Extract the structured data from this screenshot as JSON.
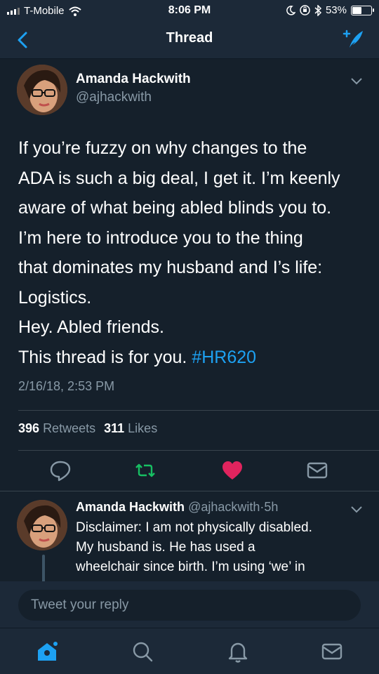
{
  "status_bar": {
    "carrier": "T-Mobile",
    "time": "8:06 PM",
    "battery": "53%",
    "battery_level": 0.53
  },
  "nav": {
    "title": "Thread",
    "back_icon": "chevron-left-icon",
    "compose_icon": "compose-tweet-icon"
  },
  "tweet": {
    "author_name": "Amanda Hackwith",
    "author_handle": "@ajhackwith",
    "lines": [
      "If you’re fuzzy on why changes to the",
      "ADA is such a big deal, I get it. I’m keenly",
      "aware of what being abled blinds you to.",
      "I’m here to introduce you to the thing",
      "that dominates my husband and I’s life:",
      "Logistics.",
      "Hey. Abled friends.",
      "This thread is for you."
    ],
    "hashtag": "#HR620",
    "timestamp": "2/16/18, 2:53 PM",
    "retweets_count": "396",
    "retweets_label": "Retweets",
    "likes_count": "311",
    "likes_label": "Likes",
    "liked": true,
    "colors": {
      "accent": "#1da1f2",
      "retweet": "#17bf63",
      "like": "#e0245e",
      "muted": "#8899a6"
    }
  },
  "reply": {
    "author_name": "Amanda Hackwith",
    "author_handle": "@ajhackwith",
    "separator": "·",
    "age": "5h",
    "lines": [
      "Disclaimer: I am not physically disabled.",
      "My husband is. He has used a",
      "wheelchair since birth. I’m using ‘we’ in"
    ]
  },
  "composer": {
    "placeholder": "Tweet your reply"
  },
  "tabbar": {
    "items": [
      "home-icon",
      "search-icon",
      "notifications-icon",
      "messages-icon"
    ],
    "active": "home-icon"
  }
}
